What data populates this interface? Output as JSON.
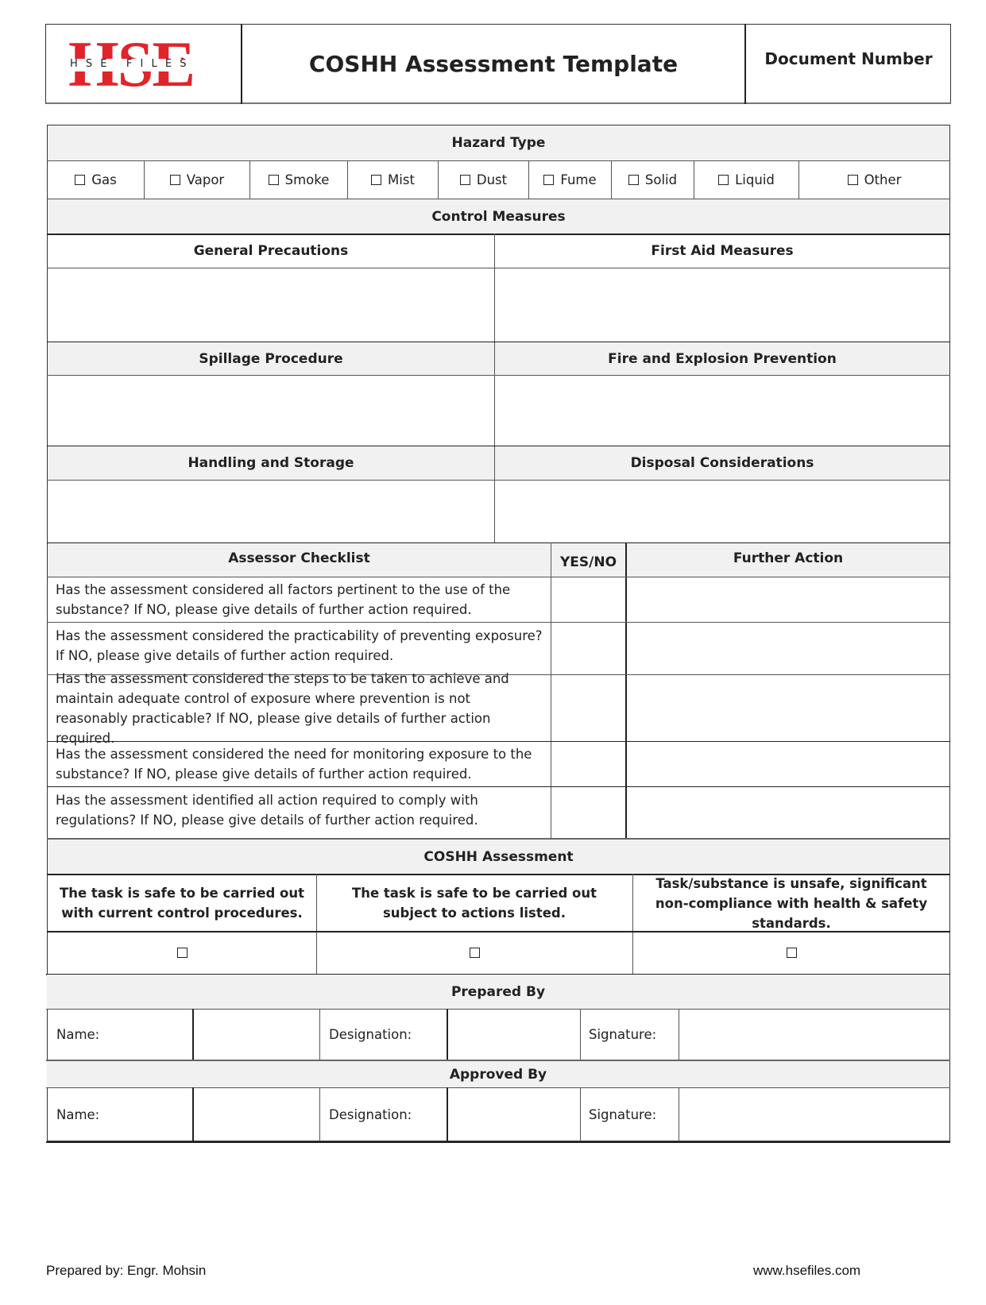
{
  "header": {
    "logo": {
      "mark": "HSE",
      "wordmark": "H S E   F I L E S",
      "color": "#e1242a"
    },
    "title": "COSHH Assessment Template",
    "document_number_label": "Document Number"
  },
  "hazard_type": {
    "title": "Hazard Type",
    "options": [
      {
        "label": "Gas",
        "checked": false
      },
      {
        "label": "Vapor",
        "checked": false
      },
      {
        "label": "Smoke",
        "checked": false
      },
      {
        "label": "Mist",
        "checked": false
      },
      {
        "label": "Dust",
        "checked": false
      },
      {
        "label": "Fume",
        "checked": false
      },
      {
        "label": "Solid",
        "checked": false
      },
      {
        "label": "Liquid",
        "checked": false
      },
      {
        "label": "Other",
        "checked": false
      }
    ]
  },
  "control_measures": {
    "title": "Control Measures",
    "sections": [
      {
        "label": "General Precautions",
        "value": ""
      },
      {
        "label": "First Aid Measures",
        "value": ""
      },
      {
        "label": "Spillage Procedure",
        "value": ""
      },
      {
        "label": "Fire and Explosion Prevention",
        "value": ""
      },
      {
        "label": "Handling and Storage",
        "value": ""
      },
      {
        "label": "Disposal Considerations",
        "value": ""
      }
    ]
  },
  "assessor_checklist": {
    "headers": [
      "Assessor Checklist",
      "YES/NO",
      "Further Action"
    ],
    "rows": [
      {
        "question": "Has the assessment considered all factors pertinent to the use of the substance? If NO, please give details of further action required.",
        "yes_no": "",
        "further_action": ""
      },
      {
        "question": "Has the assessment considered the practicability of preventing exposure? If NO, please give details of further action required.",
        "yes_no": "",
        "further_action": ""
      },
      {
        "question": "Has the assessment considered the steps to be taken to achieve and maintain adequate control of exposure where prevention is not reasonably practicable? If NO, please give details of further action required.",
        "yes_no": "",
        "further_action": ""
      },
      {
        "question": "Has the assessment considered the need for monitoring exposure to the substance? If NO, please give details of further action required.",
        "yes_no": "",
        "further_action": ""
      },
      {
        "question": "Has the assessment identified all action required to comply with regulations? If NO, please give details of further action required.",
        "yes_no": "",
        "further_action": ""
      }
    ]
  },
  "coshh_assessment": {
    "title": "COSHH Assessment",
    "options": [
      {
        "label": "The task is safe to be carried out with current control procedures.",
        "checked": false
      },
      {
        "label": "The task is safe to be carried out subject to actions listed.",
        "checked": false
      },
      {
        "label": "Task/substance is unsafe, significant non-compliance with health & safety standards.",
        "checked": false
      }
    ]
  },
  "prepared_by": {
    "title": "Prepared By",
    "name_label": "Name:",
    "name_value": "",
    "designation_label": "Designation:",
    "designation_value": "",
    "signature_label": "Signature:",
    "signature_value": ""
  },
  "approved_by": {
    "title": "Approved By",
    "name_label": "Name:",
    "name_value": "",
    "designation_label": "Designation:",
    "designation_value": "",
    "signature_label": "Signature:",
    "signature_value": ""
  },
  "footer": {
    "prepared_by": "Prepared by: Engr. Mohsin",
    "website": "www.hsefiles.com"
  }
}
